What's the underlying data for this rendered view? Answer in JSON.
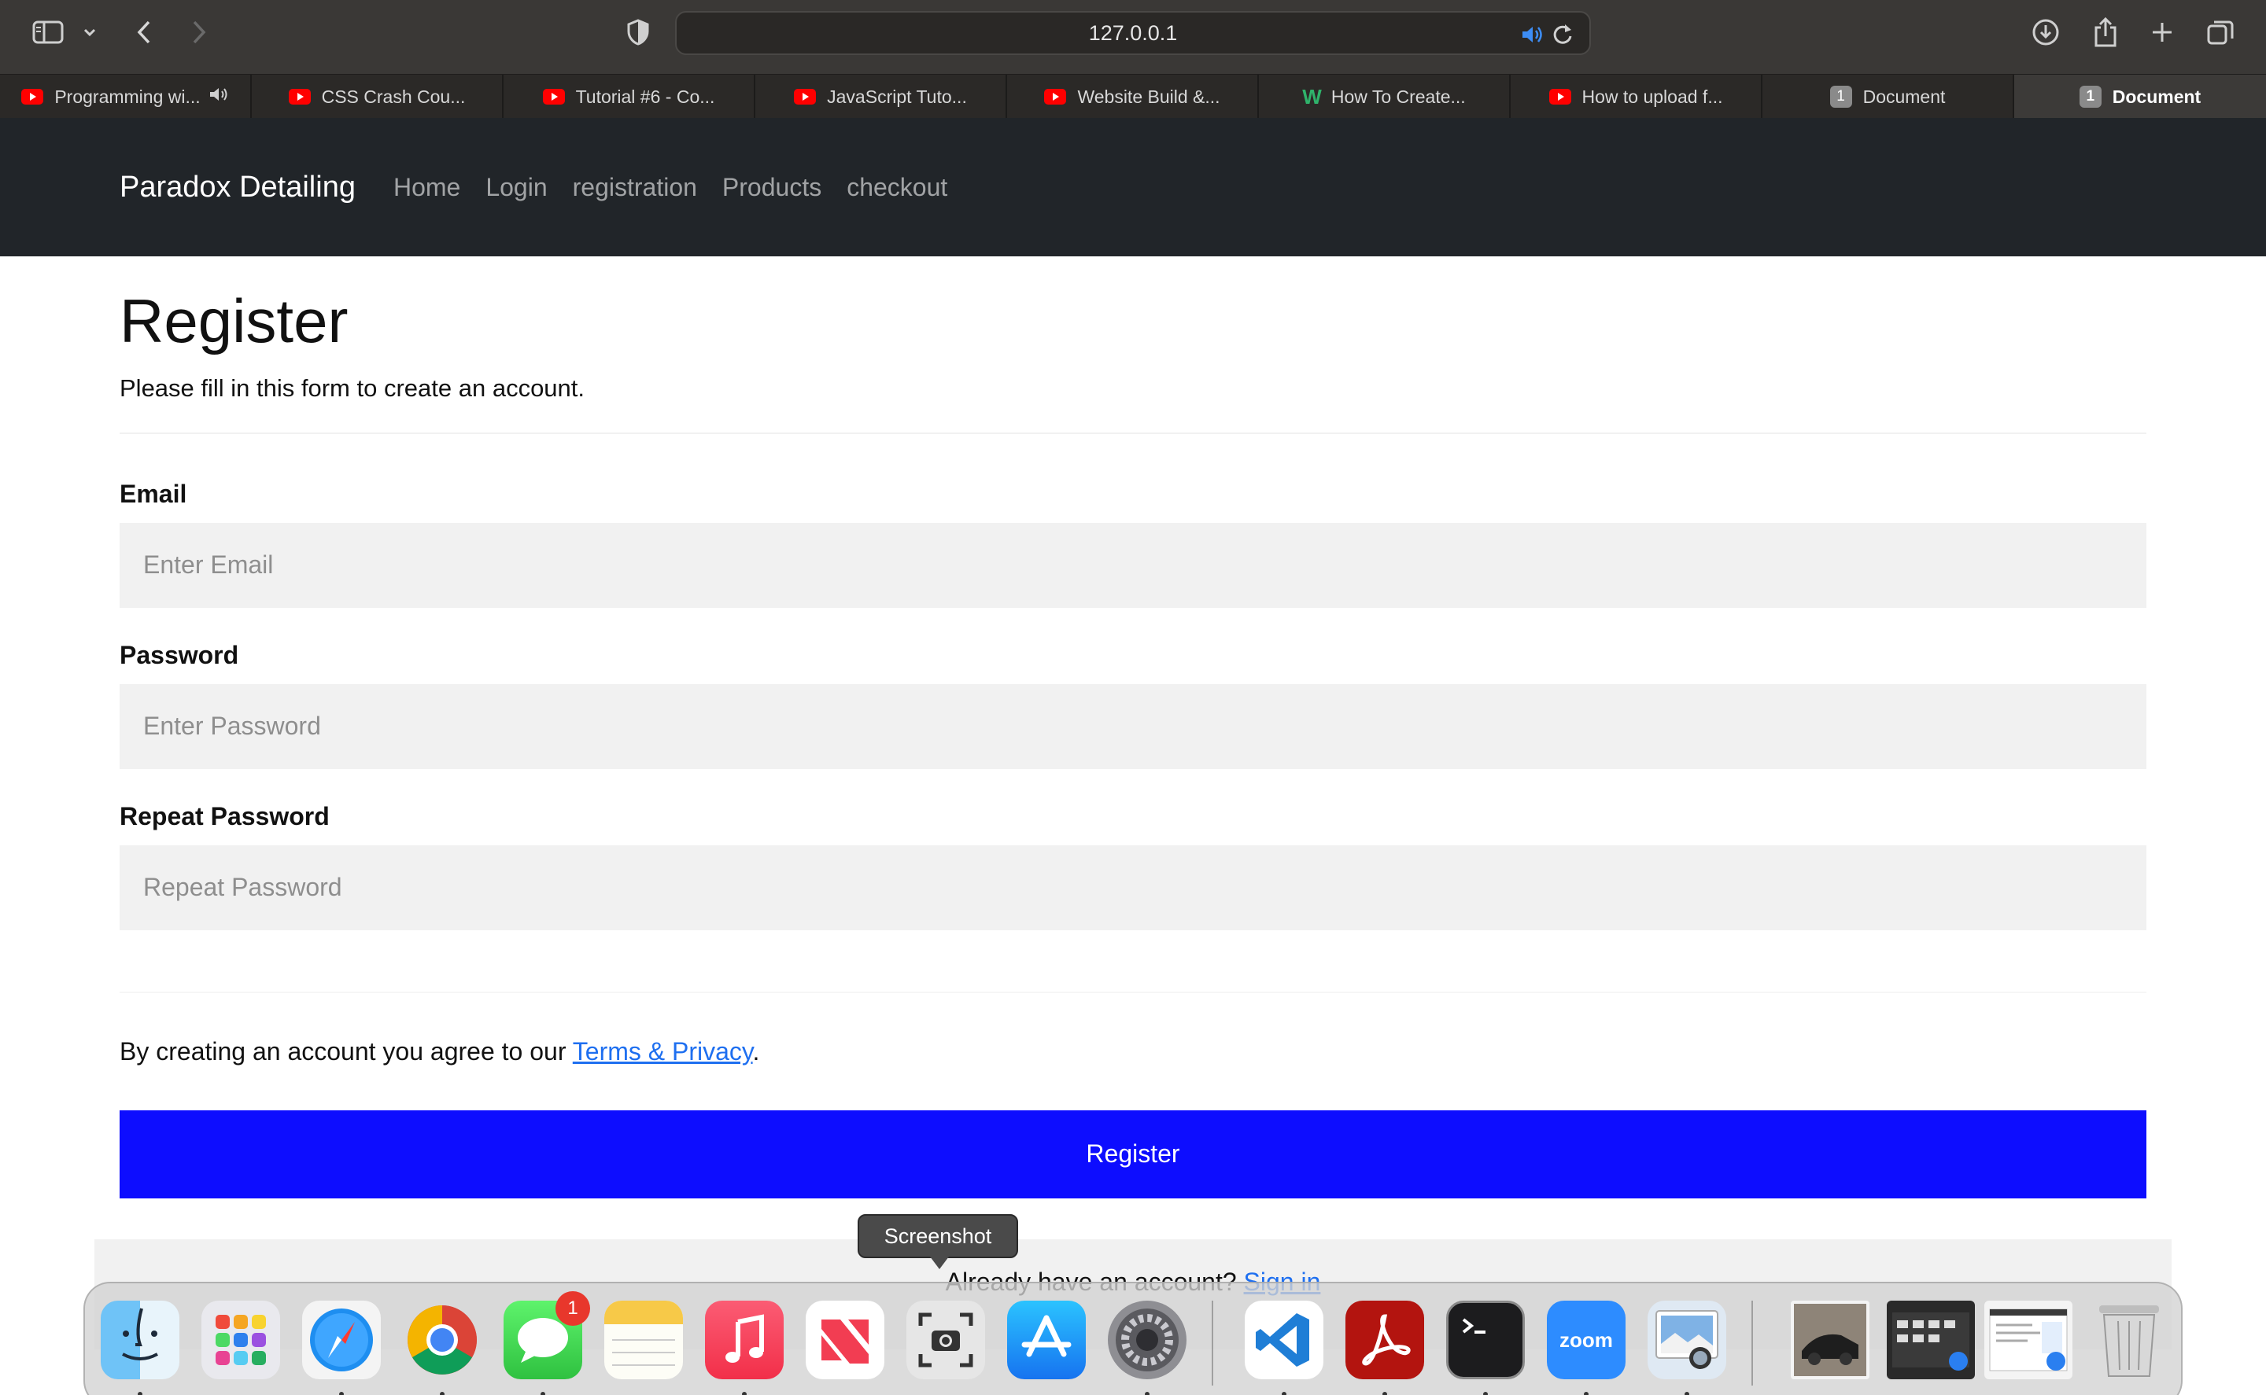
{
  "browser": {
    "url": "127.0.0.1"
  },
  "tabs": [
    {
      "label": "Programming wi...",
      "favicon": "youtube-icon",
      "muted_icon": true
    },
    {
      "label": "CSS Crash Cou...",
      "favicon": "youtube-icon"
    },
    {
      "label": "Tutorial #6 - Co...",
      "favicon": "youtube-icon"
    },
    {
      "label": "JavaScript Tuto...",
      "favicon": "youtube-icon"
    },
    {
      "label": "Website Build &...",
      "favicon": "youtube-icon"
    },
    {
      "label": "How To Create...",
      "favicon": "w-icon"
    },
    {
      "label": "How to upload f...",
      "favicon": "youtube-icon"
    },
    {
      "label": "Document",
      "favicon": "number-icon",
      "favicon_text": "1"
    },
    {
      "label": "Document",
      "favicon": "number-icon",
      "favicon_text": "1",
      "active": true
    }
  ],
  "navbar": {
    "brand": "Paradox Detailing",
    "links": [
      "Home",
      "Login",
      "registration",
      "Products",
      "checkout"
    ]
  },
  "form": {
    "title": "Register",
    "subtitle": "Please fill in this form to create an account.",
    "email_label": "Email",
    "email_placeholder": "Enter Email",
    "password_label": "Password",
    "password_placeholder": "Enter Password",
    "repeat_label": "Repeat Password",
    "repeat_placeholder": "Repeat Password",
    "terms_prefix": "By creating an account you agree to our ",
    "terms_link": "Terms & Privacy",
    "terms_suffix": ".",
    "register_button": "Register",
    "signin_prefix": "Already have an account? ",
    "signin_link": "Sign in"
  },
  "tooltip": "Screenshot",
  "dock": {
    "apps": [
      "finder-icon",
      "launchpad-icon",
      "safari-icon",
      "chrome-icon",
      "messages-icon",
      "notes-icon",
      "music-icon",
      "news-icon",
      "screenshot-icon",
      "app-store-icon",
      "system-settings-icon",
      "vscode-icon",
      "acrobat-icon",
      "terminal-icon",
      "zoom-icon",
      "preview-icon",
      "photo-thumbnail-icon",
      "desktop-stack-icon",
      "document-stack-icon",
      "trash-icon"
    ],
    "messages_badge": "1",
    "zoom_label": "zoom"
  },
  "colors": {
    "navbar_bg": "#212529",
    "register_button": "#0d0dff",
    "link": "#1e6ff0",
    "input_bg": "#f1f1f1"
  }
}
